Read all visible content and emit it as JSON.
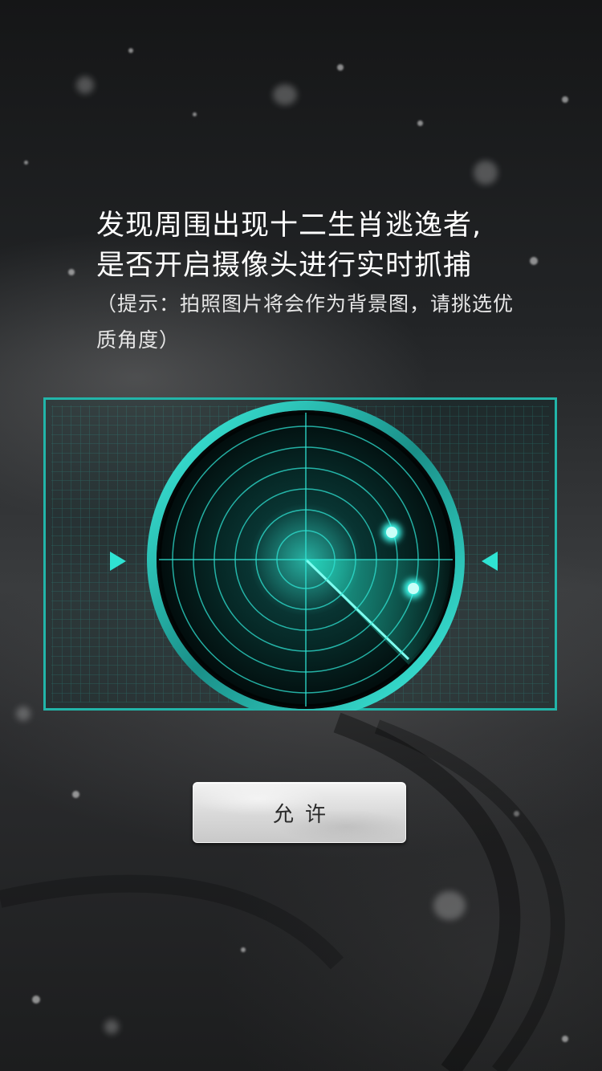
{
  "prompt": {
    "line1": "发现周围出现十二生肖逃逸者,",
    "line2": "是否开启摄像头进行实时抓捕",
    "hint": "（提示：拍照图片将会作为背景图，请挑选优质角度）"
  },
  "radar": {
    "icon": "radar-scanner",
    "accent": "#2fe3d3",
    "frame_color": "#22b5a9",
    "left_arrow_icon": "triangle-right-icon",
    "right_arrow_icon": "triangle-left-icon"
  },
  "actions": {
    "allow_label": "允许"
  },
  "colors": {
    "background": "#1a1b1d",
    "text": "#ffffff",
    "button_text": "#2a2a2a"
  }
}
